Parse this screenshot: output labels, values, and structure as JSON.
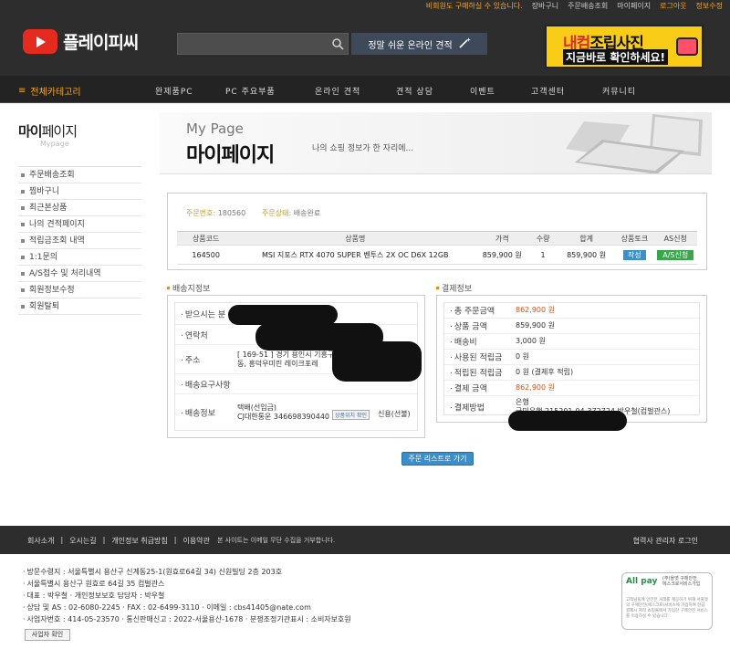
{
  "topbar": {
    "notice": "비회원도 구매하실 수 있습니다.",
    "links": [
      "장바구니",
      "주문배송조회",
      "마이페이지"
    ],
    "logout": "로그아웃",
    "edit": "정보수정"
  },
  "logo": {
    "text": "플레이피씨"
  },
  "quote": {
    "label": "정말 쉬운 온라인 견적"
  },
  "banner": {
    "line1_a": "내컴",
    "line1_b": "조립사진",
    "line2": "지금바로 확인하세요!"
  },
  "nav": {
    "category": "전체카테고리",
    "items": [
      "완제품PC",
      "PC 주요부품",
      "온라인 견적",
      "견적 상담",
      "이벤트",
      "고객센터",
      "커뮤니티"
    ]
  },
  "side": {
    "title_a": "마이",
    "title_b": "페이지",
    "sub": "Mypage",
    "items": [
      "주문배송조회",
      "찜바구니",
      "최근본상품",
      "나의 견적페이지",
      "적립금조회 내역",
      "1:1문의",
      "A/S접수 및 처리내역",
      "회원정보수정",
      "회원탈퇴"
    ]
  },
  "hero": {
    "en": "My Page",
    "ko": "마이페이지",
    "desc": "나의 쇼핑 정보가 한 자리에..."
  },
  "order": {
    "no_label": "주문번호:",
    "no": "180560",
    "status_label": "주문상태:",
    "status": "배송완료",
    "headers": [
      "상품코드",
      "상품명",
      "가격",
      "수량",
      "합계",
      "상품토크",
      "AS신청"
    ],
    "row": {
      "code": "164500",
      "name": "MSI 지포스 RTX 4070 SUPER 벤투스 2X OC D6X 12GB",
      "price": "859,900 원",
      "qty": "1",
      "total": "859,900 원",
      "talk": "작성",
      "as": "A/S신청"
    }
  },
  "ship": {
    "head": "배송지정보",
    "rows": [
      {
        "k": "받으시는 분",
        "v": ""
      },
      {
        "k": "연락처",
        "v": ""
      },
      {
        "k": "주소",
        "v": "[ 169-51 ] 경기 용인시 기흥구 흥덕2로1\n동, 흥덕우미린 레이크포레"
      },
      {
        "k": "배송요구사항",
        "v": ""
      },
      {
        "k": "배송정보",
        "v": "택배(선입금)\nCJ대한통운 346698390440"
      }
    ],
    "track": "상품위치 확인",
    "fee": "신용(선불)"
  },
  "pay": {
    "head": "결제정보",
    "rows": [
      {
        "k": "총 주문금액",
        "v": "862,900 원",
        "red": true
      },
      {
        "k": "상품 금액",
        "v": "859,900 원"
      },
      {
        "k": "배송비",
        "v": "3,000 원"
      },
      {
        "k": "사용된 적립금",
        "v": "0 원"
      },
      {
        "k": "적립된 적립금",
        "v": "0 원 (결제후 적립)"
      },
      {
        "k": "결제 금액",
        "v": "862,900 원",
        "red": true
      },
      {
        "k": "결제방법",
        "v": "은행\n국민은행 215201-04-372724 박우철(컴벌관스)"
      }
    ]
  },
  "list_button": "주문 리스트로 가기",
  "footer": {
    "links": [
      "회사소개",
      "오시는길",
      "개인정보 취급방침",
      "이용약관"
    ],
    "notice": "본 사이트는 이메일 무단 수집을 거부합니다.",
    "admin": "협력사 관리자 로그인"
  },
  "info": [
    "방문수령지 : 서울특별시 용산구 신계동25-1(원효로64길 34) 신원빌딩 2층 203호",
    "서울특별시 용산구 원효로 64길 35 컴벌관스",
    "대표 : 박우철   · 개인정보보호 담당자 : 박우철",
    "상담 및 AS : 02-6080-2245   · FAX : 02-6499-3110   · 이메일 : cbs41405@nate.com",
    "사업자번호 : 414-05-23570   · 통신판매신고 : 2022-서울용산-1678   · 분쟁조정기관표시 : 소비자보호원"
  ],
  "info_button": "사업자 확인",
  "escrow": {
    "title": "All pay",
    "sub": "(주)올앳 구매안전\n에스크로서비스가입",
    "desc": "고객님들께 안전한 거래를 제공하기 위해 서울앳의 구매안전(에스크로)서비스에 가입하여 현금 결제시 저희 쇼핑몰에서 가입한 구매안전 서비스를 이용하실 수 있습니다."
  }
}
